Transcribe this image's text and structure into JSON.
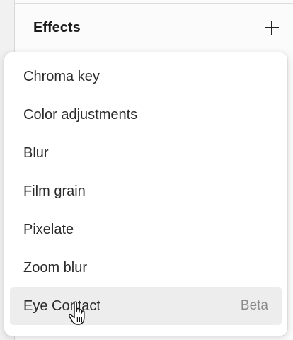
{
  "panel": {
    "title": "Effects",
    "add_icon": "plus-icon"
  },
  "menu": {
    "items": [
      {
        "label": "Chroma key",
        "badge": ""
      },
      {
        "label": "Color adjustments",
        "badge": ""
      },
      {
        "label": "Blur",
        "badge": ""
      },
      {
        "label": "Film grain",
        "badge": ""
      },
      {
        "label": "Pixelate",
        "badge": ""
      },
      {
        "label": "Zoom blur",
        "badge": ""
      },
      {
        "label": "Eye Contact",
        "badge": "Beta"
      }
    ],
    "hovered_item": "Eye Contact"
  },
  "cursor": "hand-pointer-icon",
  "colors": {
    "panel_bg": "#fbfbfb",
    "menu_bg": "#ffffff",
    "hover_bg": "#ededed",
    "badge_text": "#8a8a8a"
  }
}
